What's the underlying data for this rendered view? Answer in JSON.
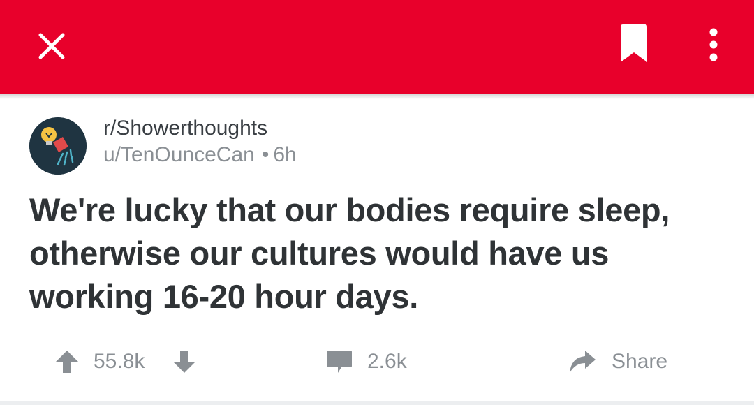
{
  "toolbar": {
    "background_color": "#e8002b",
    "close_icon": "close-icon",
    "bookmark_icon": "bookmark-icon",
    "more_icon": "more-vertical-icon"
  },
  "post": {
    "subreddit": "r/Showerthoughts",
    "author": "u/TenOunceCan",
    "separator": "•",
    "age": "6h",
    "title": "We're lucky that our bodies require sleep, otherwise our cultures would have us working 16-20 hour days.",
    "avatar_icon": "showerhead-lightbulb-icon"
  },
  "actions": {
    "upvote_icon": "arrow-up-icon",
    "score": "55.8k",
    "downvote_icon": "arrow-down-icon",
    "comment_icon": "comment-icon",
    "comments": "2.6k",
    "share_icon": "share-arrow-icon",
    "share_label": "Share"
  }
}
